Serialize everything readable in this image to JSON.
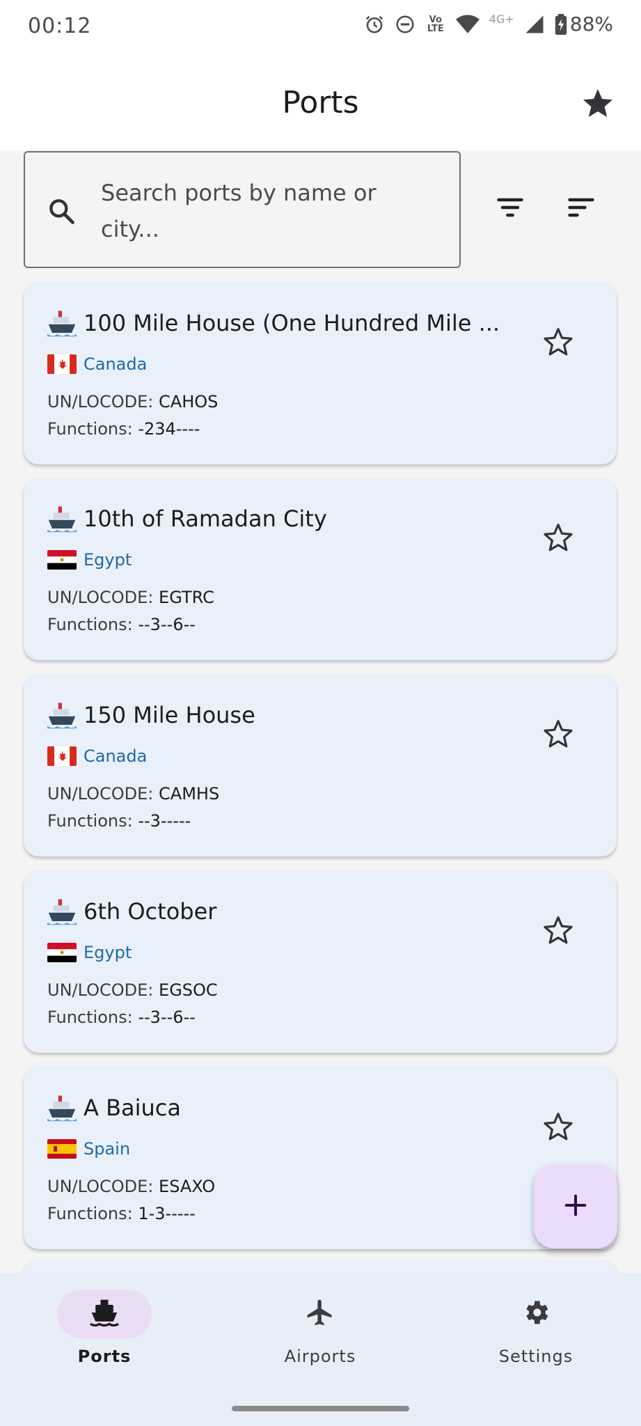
{
  "status_bar": {
    "time": "00:12",
    "network_label": "4G+",
    "volte_label": "Vo LTE",
    "battery": "88%"
  },
  "app_bar": {
    "title": "Ports",
    "favorites_icon": "star-filled-icon"
  },
  "search": {
    "placeholder": "Search ports by name or city..."
  },
  "toolbar": {
    "filter_icon": "filter-icon",
    "sort_icon": "sort-icon"
  },
  "ports": [
    {
      "name": "100 Mile House (One Hundred Mile ...",
      "country": "Canada",
      "flag": "ca",
      "locode_label": "UN/LOCODE:",
      "locode": "CAHOS",
      "functions_label": "Functions:",
      "functions": "-234----"
    },
    {
      "name": "10th of Ramadan City",
      "country": "Egypt",
      "flag": "eg",
      "locode_label": "UN/LOCODE:",
      "locode": "EGTRC",
      "functions_label": "Functions:",
      "functions": "--3--6--"
    },
    {
      "name": "150 Mile House",
      "country": "Canada",
      "flag": "ca",
      "locode_label": "UN/LOCODE:",
      "locode": "CAMHS",
      "functions_label": "Functions:",
      "functions": "--3-----"
    },
    {
      "name": "6th October",
      "country": "Egypt",
      "flag": "eg",
      "locode_label": "UN/LOCODE:",
      "locode": "EGSOC",
      "functions_label": "Functions:",
      "functions": "--3--6--"
    },
    {
      "name": "A Baiuca",
      "country": "Spain",
      "flag": "es",
      "locode_label": "UN/LOCODE:",
      "locode": "ESAXO",
      "functions_label": "Functions:",
      "functions": "1-3-----"
    }
  ],
  "fab": {
    "icon": "plus-icon"
  },
  "bottom_nav": {
    "items": [
      {
        "label": "Ports",
        "icon": "ship-icon",
        "active": true
      },
      {
        "label": "Airports",
        "icon": "airplane-icon",
        "active": false
      },
      {
        "label": "Settings",
        "icon": "gear-icon",
        "active": false
      }
    ]
  },
  "colors": {
    "accent": "#1f6aa8",
    "fab_bg": "#ecdcfb",
    "card_bg": "#eaf0f9",
    "nav_bg": "#e8eef7"
  }
}
